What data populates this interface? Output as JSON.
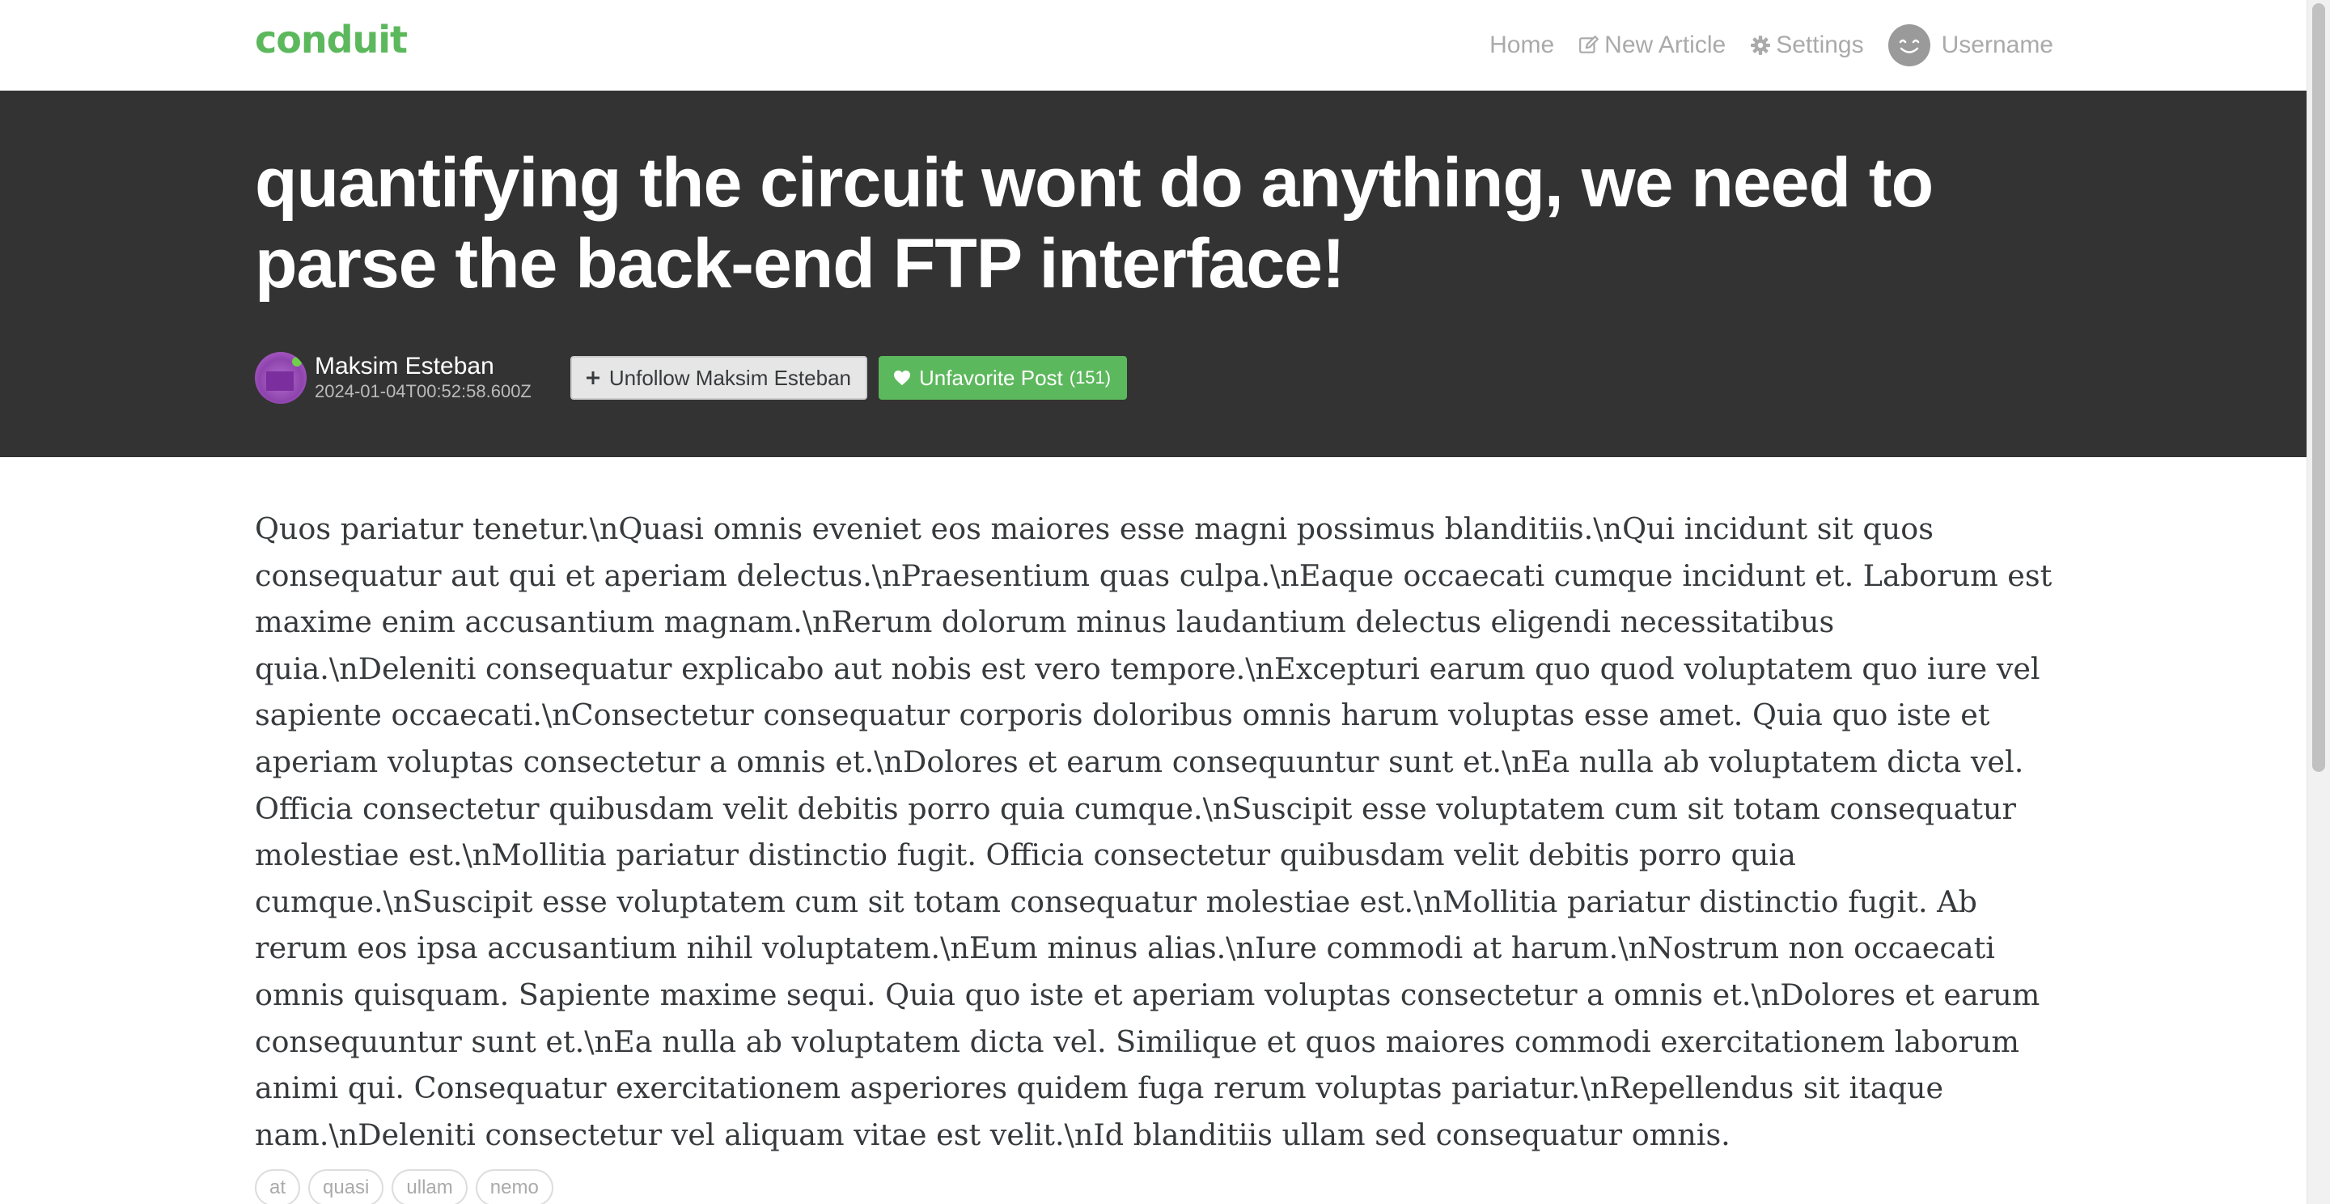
{
  "navbar": {
    "brand": "conduit",
    "items": [
      {
        "label": "Home",
        "icon": "none"
      },
      {
        "label": "New Article",
        "icon": "edit-icon"
      },
      {
        "label": "Settings",
        "icon": "gear-icon"
      },
      {
        "label": "Username",
        "icon": "avatar"
      }
    ]
  },
  "article": {
    "title": "quantifying the circuit wont do anything, we need to parse the back-end FTP interface!",
    "author": "Maksim Esteban",
    "date": "2024-01-04T00:52:58.600Z",
    "follow_label": "Unfollow Maksim Esteban",
    "favorite_label": "Unfavorite Post",
    "favorite_count": "(151)",
    "body": "Quos pariatur tenetur.\\nQuasi omnis eveniet eos maiores esse magni possimus blanditiis.\\nQui incidunt sit quos consequatur aut qui et aperiam delectus.\\nPraesentium quas culpa.\\nEaque occaecati cumque incidunt et. Laborum est maxime enim accusantium magnam.\\nRerum dolorum minus laudantium delectus eligendi necessitatibus quia.\\nDeleniti consequatur explicabo aut nobis est vero tempore.\\nExcepturi earum quo quod voluptatem quo iure vel sapiente occaecati.\\nConsectetur consequatur corporis doloribus omnis harum voluptas esse amet. Quia quo iste et aperiam voluptas consectetur a omnis et.\\nDolores et earum consequuntur sunt et.\\nEa nulla ab voluptatem dicta vel. Officia consectetur quibusdam velit debitis porro quia cumque.\\nSuscipit esse voluptatem cum sit totam consequatur molestiae est.\\nMollitia pariatur distinctio fugit. Officia consectetur quibusdam velit debitis porro quia cumque.\\nSuscipit esse voluptatem cum sit totam consequatur molestiae est.\\nMollitia pariatur distinctio fugit. Ab rerum eos ipsa accusantium nihil voluptatem.\\nEum minus alias.\\nIure commodi at harum.\\nNostrum non occaecati omnis quisquam. Sapiente maxime sequi. Quia quo iste et aperiam voluptas consectetur a omnis et.\\nDolores et earum consequuntur sunt et.\\nEa nulla ab voluptatem dicta vel. Similique et quos maiores commodi exercitationem laborum animi qui. Consequatur exercitationem asperiores quidem fuga rerum voluptas pariatur.\\nRepellendus sit itaque nam.\\nDeleniti consectetur vel aliquam vitae est velit.\\nId blanditiis ullam sed consequatur omnis.",
    "tags": [
      "at",
      "quasi",
      "ullam",
      "nemo"
    ]
  },
  "colors": {
    "brand": "#5cb85c",
    "banner_bg": "#333333",
    "favorite_button": "#5cb85c",
    "nav_text": "#aaaaaa",
    "body_text": "#373a3c"
  }
}
